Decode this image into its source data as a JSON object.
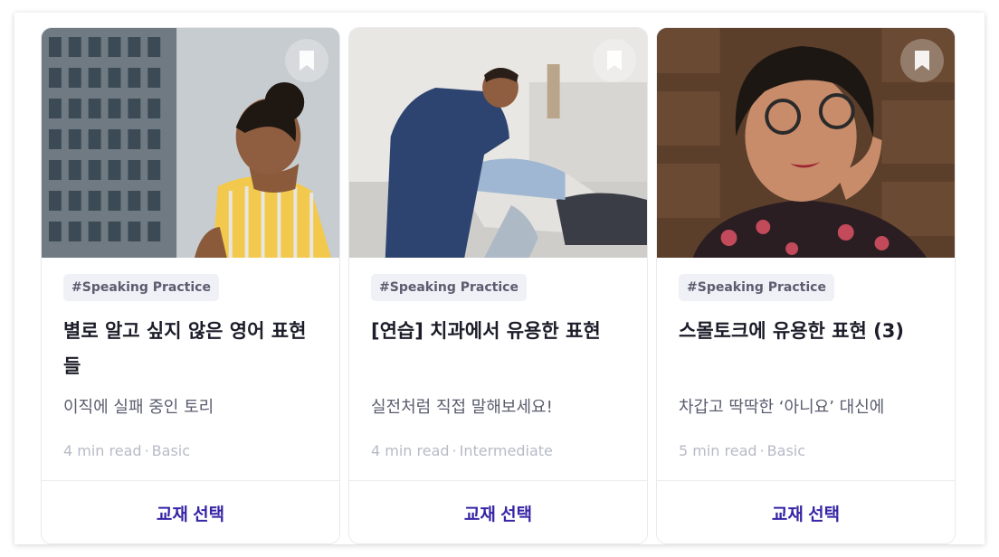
{
  "cards": [
    {
      "tag": "#Speaking Practice",
      "title": "별로 알고 싶지 않은 영어 표현들",
      "subtitle": "이직에 실패 중인 토리",
      "read_time": "4 min read",
      "level": "Basic",
      "button_label": "교재 선택",
      "image_icon": "photo-woman-office-building"
    },
    {
      "tag": "#Speaking Practice",
      "title": "[연습] 치과에서 유용한 표현",
      "subtitle": "실전처럼 직접 말해보세요!",
      "read_time": "4 min read",
      "level": "Intermediate",
      "button_label": "교재 선택",
      "image_icon": "photo-dentist-patient"
    },
    {
      "tag": "#Speaking Practice",
      "title": "스몰토크에 유용한 표현 (3)",
      "subtitle": "차갑고 딱딱한 ‘아니요’ 대신에",
      "read_time": "5 min read",
      "level": "Basic",
      "button_label": "교재 선택",
      "image_icon": "photo-thinking-woman"
    }
  ],
  "separator": "·",
  "colors": {
    "accent": "#3525a6",
    "tag_bg": "#f0f0f7",
    "title": "#1c1d29",
    "meta": "#b8bac6"
  }
}
